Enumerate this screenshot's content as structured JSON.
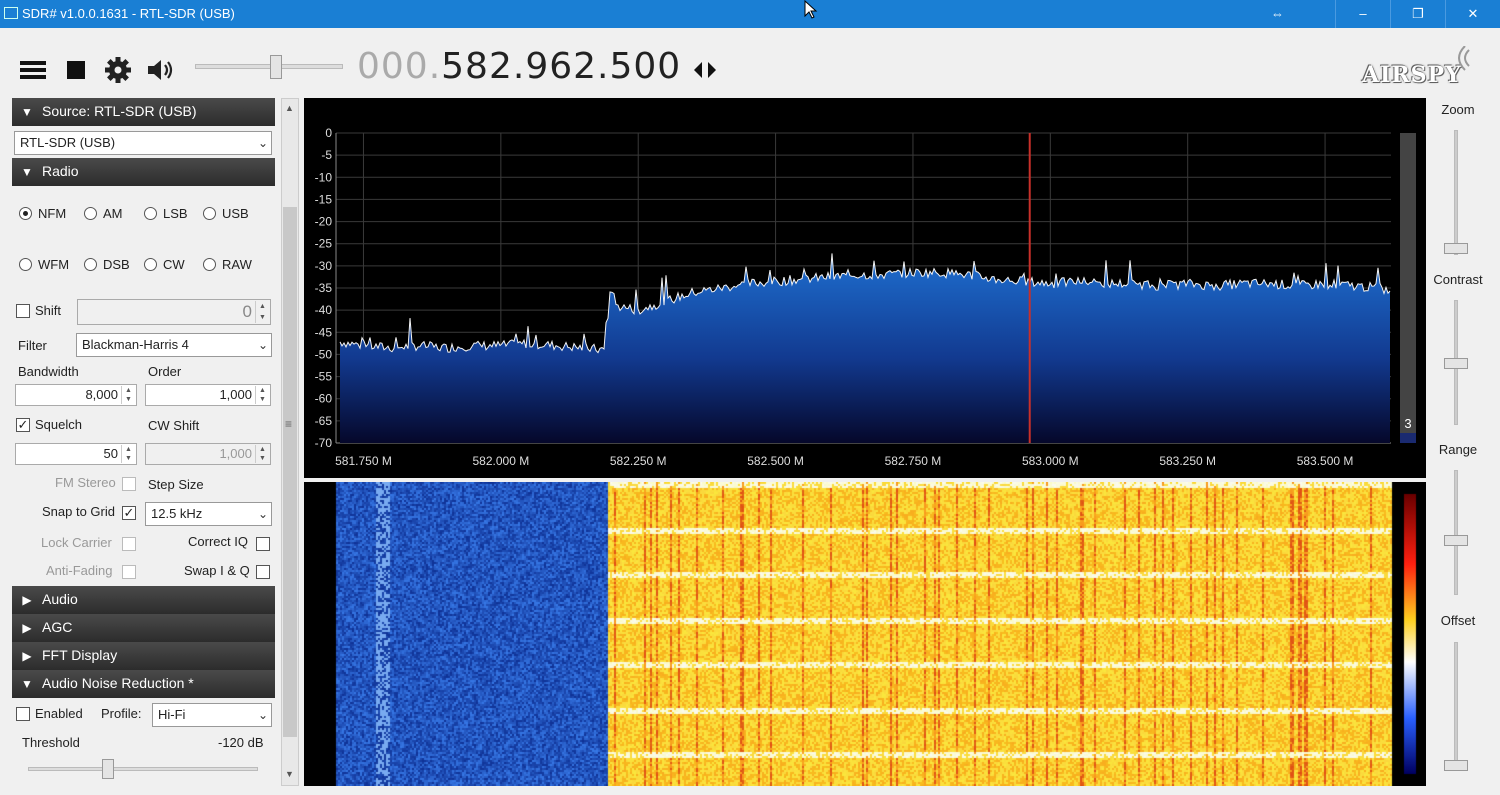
{
  "window": {
    "title": "SDR# v1.0.0.1631 - RTL-SDR (USB)"
  },
  "toolbar": {
    "menu_icon": "hamburger-icon",
    "stop_icon": "stop-icon",
    "settings_icon": "gear-icon",
    "volume_icon": "speaker-icon",
    "volume_level": 0.55,
    "frequency_dim": "000.",
    "frequency_lit": "582.962.500",
    "tune_icon": "arrows-left-right-icon",
    "logo": "AIRSPY"
  },
  "source": {
    "header": "Source: RTL-SDR (USB)",
    "device": "RTL-SDR (USB)"
  },
  "radio": {
    "header": "Radio",
    "modes": [
      "NFM",
      "AM",
      "LSB",
      "USB",
      "WFM",
      "DSB",
      "CW",
      "RAW"
    ],
    "selected_mode": "NFM",
    "shift_label": "Shift",
    "shift_value": "0",
    "filter_label": "Filter",
    "filter_value": "Blackman-Harris 4",
    "bandwidth_label": "Bandwidth",
    "bandwidth_value": "8,000",
    "order_label": "Order",
    "order_value": "1,000",
    "squelch_label": "Squelch",
    "squelch_value": "50",
    "cw_shift_label": "CW Shift",
    "cw_shift_value": "1,000",
    "fm_stereo_label": "FM Stereo",
    "step_size_label": "Step Size",
    "snap_label": "Snap to Grid",
    "step_value": "12.5 kHz",
    "lock_carrier_label": "Lock Carrier",
    "correct_iq_label": "Correct IQ",
    "anti_fading_label": "Anti-Fading",
    "swap_iq_label": "Swap I & Q"
  },
  "collapsed_sections": [
    "Audio",
    "AGC",
    "FFT Display"
  ],
  "noise_reduction": {
    "header": "Audio Noise Reduction *",
    "enabled_label": "Enabled",
    "profile_label": "Profile:",
    "profile_value": "Hi-Fi",
    "threshold_label": "Threshold",
    "threshold_value": "-120 dB",
    "threshold_level": 0.34
  },
  "right_controls": {
    "zoom": "Zoom",
    "contrast": "Contrast",
    "range": "Range",
    "offset": "Offset"
  },
  "chart_data": {
    "type": "area",
    "y_ticks": [
      "0",
      "-5",
      "-10",
      "-15",
      "-20",
      "-25",
      "-30",
      "-35",
      "-40",
      "-45",
      "-50",
      "-55",
      "-60",
      "-65",
      "-70"
    ],
    "ylim": [
      -70,
      0
    ],
    "x_ticks": [
      "581.750 M",
      "582.000 M",
      "582.250 M",
      "582.500 M",
      "582.750 M",
      "583.000 M",
      "583.250 M",
      "583.500 M"
    ],
    "xlim_mhz": [
      581.7,
      583.62
    ],
    "tuned_frequency_mhz": 582.9625,
    "peak_hold_label": "3",
    "series": [
      {
        "x_mhz": [
          581.7,
          581.75,
          581.8,
          581.85,
          581.9,
          581.95,
          582.0,
          582.05,
          582.1,
          582.15,
          582.19,
          582.2,
          582.21,
          582.25,
          582.3,
          582.35,
          582.4,
          582.45,
          582.5,
          582.55,
          582.6,
          582.65,
          582.7,
          582.75,
          582.8,
          582.85,
          582.9,
          582.95,
          583.0,
          583.05,
          583.1,
          583.15,
          583.2,
          583.25,
          583.3,
          583.35,
          583.4,
          583.45,
          583.5,
          583.55,
          583.6,
          583.62
        ],
        "values_db": [
          -47,
          -48,
          -48.5,
          -48,
          -48.5,
          -48,
          -48,
          -47.5,
          -48,
          -48.5,
          -49,
          -34,
          -39,
          -40,
          -38,
          -36,
          -35,
          -34,
          -33.5,
          -33,
          -32.5,
          -32,
          -32,
          -31.5,
          -31.5,
          -32,
          -33,
          -33.5,
          -34,
          -33.5,
          -34,
          -34,
          -34.5,
          -34,
          -34.5,
          -34,
          -34,
          -34.5,
          -34,
          -34.5,
          -35,
          -36
        ]
      }
    ]
  },
  "colors": {
    "title_bar": "#1a7fd4",
    "spectrum_fill_top": "#1e6fd0",
    "spectrum_fill_bottom": "#05072a",
    "tuned_marker": "#c8302a",
    "waterfall_low": "#1840c8",
    "waterfall_high": "#f8c020"
  }
}
